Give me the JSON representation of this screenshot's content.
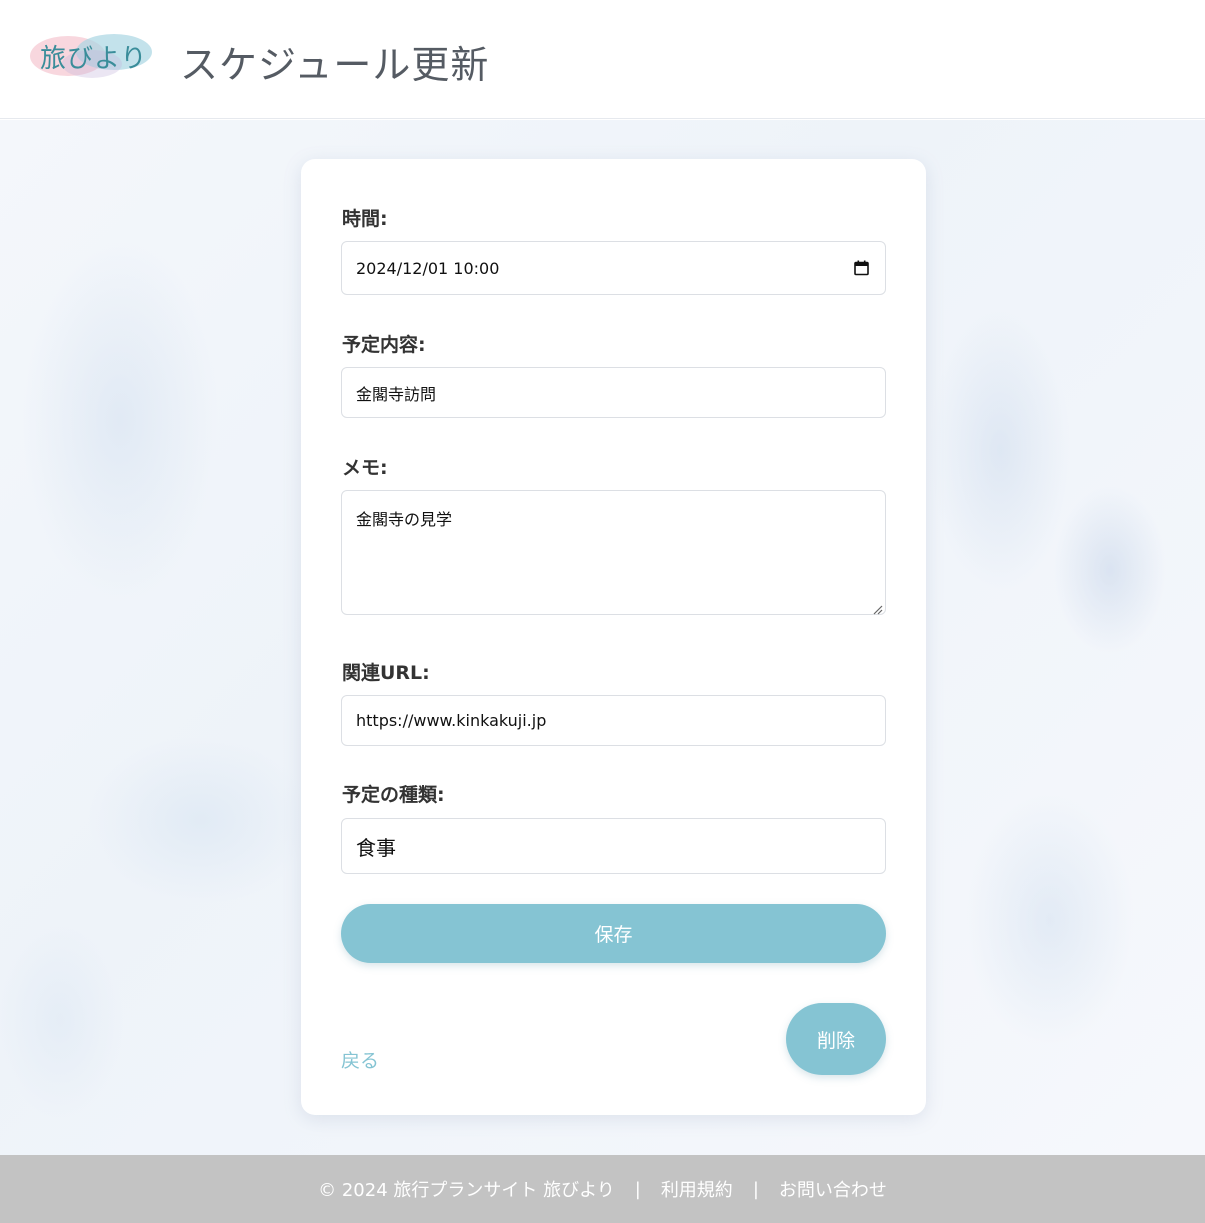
{
  "header": {
    "logo_text": "旅びより",
    "title": "スケジュール更新"
  },
  "form": {
    "time_label": "時間:",
    "time_value": "2024/12/01 10:00",
    "content_label": "予定内容:",
    "content_value": "金閣寺訪問",
    "memo_label": "メモ:",
    "memo_value": "金閣寺の見学",
    "url_label": "関連URL:",
    "url_value": "https://www.kinkakuji.jp",
    "type_label": "予定の種類:",
    "type_value": "食事",
    "save_label": "保存",
    "delete_label": "削除",
    "back_label": "戻る"
  },
  "footer": {
    "copyright": "© 2024 旅行プランサイト 旅びより",
    "separator": "|",
    "terms": "利用規約",
    "contact": "お問い合わせ"
  },
  "colors": {
    "accent": "#85c4d3",
    "footer_bg": "#c3c3c3",
    "logo_text": "#3a8d9a"
  },
  "icons": {
    "calendar": "calendar-icon",
    "resize": "resize-handle-icon"
  }
}
